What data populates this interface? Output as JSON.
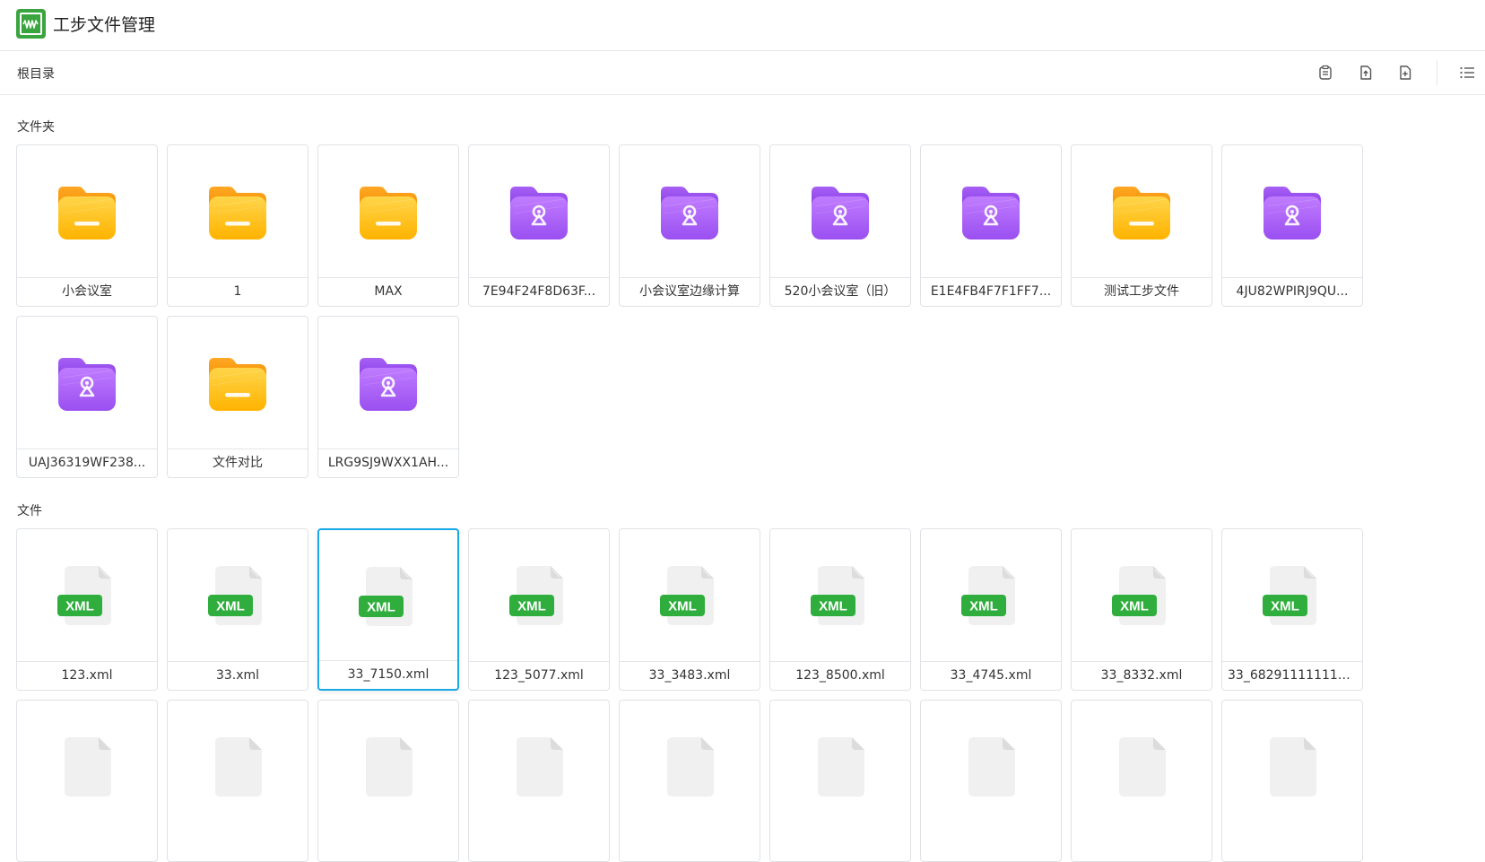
{
  "app": {
    "title": "工步文件管理"
  },
  "toolbar": {
    "breadcrumb": "根目录"
  },
  "sections": {
    "folders_label": "文件夹",
    "files_label": "文件"
  },
  "folders": [
    {
      "name": "小会议室",
      "kind": "plain"
    },
    {
      "name": "1",
      "kind": "plain"
    },
    {
      "name": "MAX",
      "kind": "plain"
    },
    {
      "name": "7E94F24F8D63F...",
      "kind": "device"
    },
    {
      "name": "小会议室边缘计算",
      "kind": "device"
    },
    {
      "name": "520小会议室（旧）",
      "kind": "device"
    },
    {
      "name": "E1E4FB4F7F1FF7...",
      "kind": "device"
    },
    {
      "name": "测试工步文件",
      "kind": "plain"
    },
    {
      "name": "4JU82WPIRJ9QU...",
      "kind": "device"
    },
    {
      "name": "UAJ36319WF238...",
      "kind": "device"
    },
    {
      "name": "文件对比",
      "kind": "plain"
    },
    {
      "name": "LRG9SJ9WXX1AH...",
      "kind": "device"
    }
  ],
  "files": [
    {
      "name": "123.xml",
      "badge": "XML"
    },
    {
      "name": "33.xml",
      "badge": "XML"
    },
    {
      "name": "33_7150.xml",
      "badge": "XML",
      "selected": true
    },
    {
      "name": "123_5077.xml",
      "badge": "XML"
    },
    {
      "name": "33_3483.xml",
      "badge": "XML"
    },
    {
      "name": "123_8500.xml",
      "badge": "XML"
    },
    {
      "name": "33_4745.xml",
      "badge": "XML"
    },
    {
      "name": "33_8332.xml",
      "badge": "XML"
    },
    {
      "name": "33_682911111111....",
      "badge": "XML"
    }
  ],
  "colors": {
    "accent": "#1aa7e6",
    "brand": "#3aa53f",
    "xml_badge": "#2fae3d",
    "folder_plain": "#ffc21f",
    "folder_device": "#a05cf0"
  }
}
